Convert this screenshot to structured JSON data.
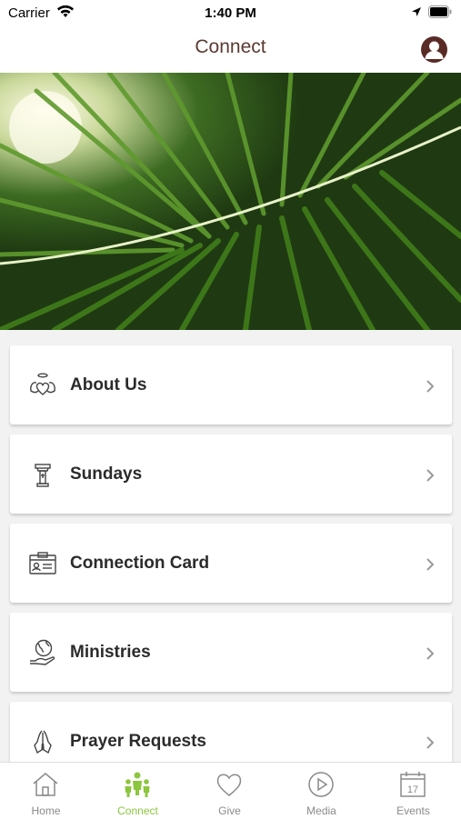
{
  "status": {
    "carrier": "Carrier",
    "time": "1:40 PM"
  },
  "header": {
    "title": "Connect"
  },
  "hero": {
    "alt": "palm leaf in sunlight"
  },
  "cards": [
    {
      "label": "About Us",
      "icon": "angel-heart-icon"
    },
    {
      "label": "Sundays",
      "icon": "lectern-icon"
    },
    {
      "label": "Connection Card",
      "icon": "id-card-icon"
    },
    {
      "label": "Ministries",
      "icon": "globe-hand-icon"
    },
    {
      "label": "Prayer Requests",
      "icon": "praying-hands-icon"
    }
  ],
  "tabs": [
    {
      "label": "Home",
      "icon": "home-icon",
      "active": false
    },
    {
      "label": "Connect",
      "icon": "people-icon",
      "active": true
    },
    {
      "label": "Give",
      "icon": "heart-icon",
      "active": false
    },
    {
      "label": "Media",
      "icon": "play-icon",
      "active": false
    },
    {
      "label": "Events",
      "icon": "calendar-icon",
      "active": false
    }
  ],
  "calendar_day": "17",
  "colors": {
    "accent": "#8cc63f",
    "title": "#5a3a30",
    "avatar": "#5a2b26"
  }
}
